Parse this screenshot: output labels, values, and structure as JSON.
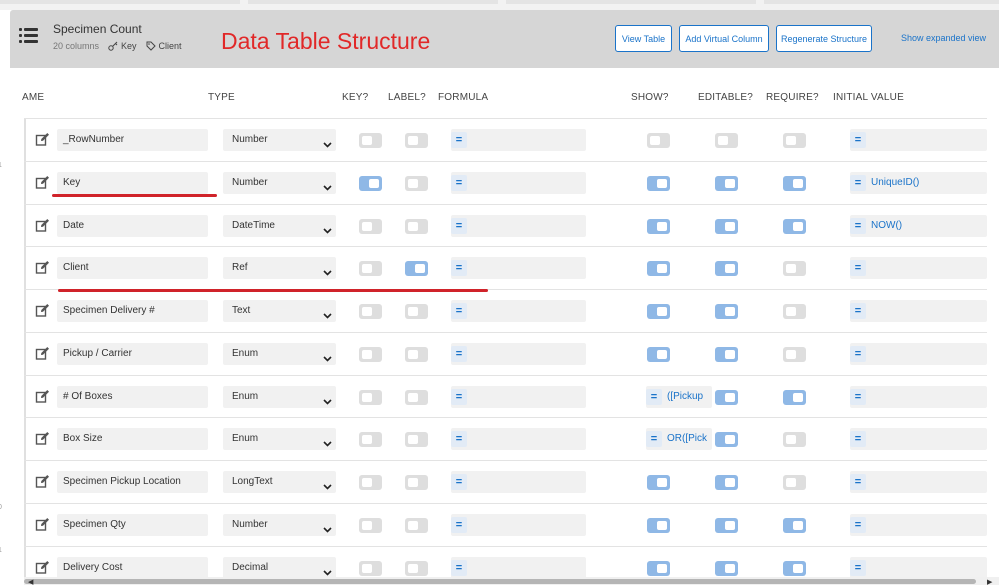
{
  "table": {
    "name": "Specimen Count",
    "columns_count": "20 columns",
    "key_column": "Key",
    "label_column": "Client"
  },
  "annotation_title": "Data Table Structure",
  "buttons": {
    "view_table": "View Table",
    "add_virtual_column": "Add Virtual Column",
    "regenerate_structure": "Regenerate Structure"
  },
  "expanded_view_link": "Show expanded view",
  "column_headers": {
    "name": "AME",
    "type": "TYPE",
    "key": "KEY?",
    "label": "LABEL?",
    "formula": "FORMULA",
    "show": "SHOW?",
    "editable": "EDITABLE?",
    "require": "REQUIRE?",
    "initial_value": "INITIAL VALUE"
  },
  "rows": [
    {
      "num": "",
      "name": "_RowNumber",
      "type": "Number",
      "key": false,
      "label": false,
      "formula": "",
      "show": false,
      "show_formula": "",
      "editable": false,
      "require": false,
      "initial_value": ""
    },
    {
      "num": "1",
      "name": "Key",
      "type": "Number",
      "key": true,
      "label": false,
      "formula": "",
      "show": true,
      "show_formula": "",
      "editable": true,
      "require": true,
      "initial_value": "UniqueID()"
    },
    {
      "num": "",
      "name": "Date",
      "type": "DateTime",
      "key": false,
      "label": false,
      "formula": "",
      "show": true,
      "show_formula": "",
      "editable": true,
      "require": true,
      "initial_value": "NOW()"
    },
    {
      "num": "",
      "name": "Client",
      "type": "Ref",
      "key": false,
      "label": true,
      "formula": "",
      "show": true,
      "show_formula": "",
      "editable": true,
      "require": false,
      "initial_value": ""
    },
    {
      "num": "",
      "name": "Specimen Delivery #",
      "type": "Text",
      "key": false,
      "label": false,
      "formula": "",
      "show": true,
      "show_formula": "",
      "editable": true,
      "require": false,
      "initial_value": ""
    },
    {
      "num": "",
      "name": "Pickup / Carrier",
      "type": "Enum",
      "key": false,
      "label": false,
      "formula": "",
      "show": true,
      "show_formula": "",
      "editable": true,
      "require": false,
      "initial_value": ""
    },
    {
      "num": "",
      "name": "# Of Boxes",
      "type": "Enum",
      "key": false,
      "label": false,
      "formula": "",
      "show": false,
      "show_formula": "([Pickup",
      "editable": true,
      "require": true,
      "initial_value": ""
    },
    {
      "num": "",
      "name": "Box Size",
      "type": "Enum",
      "key": false,
      "label": false,
      "formula": "",
      "show": false,
      "show_formula": "OR([Pick",
      "editable": true,
      "require": false,
      "initial_value": ""
    },
    {
      "num": "",
      "name": "Specimen Pickup Location",
      "type": "LongText",
      "key": false,
      "label": false,
      "formula": "",
      "show": true,
      "show_formula": "",
      "editable": true,
      "require": false,
      "initial_value": ""
    },
    {
      "num": "0",
      "name": "Specimen Qty",
      "type": "Number",
      "key": false,
      "label": false,
      "formula": "",
      "show": true,
      "show_formula": "",
      "editable": true,
      "require": true,
      "initial_value": ""
    },
    {
      "num": "1",
      "name": "Delivery Cost",
      "type": "Decimal",
      "key": false,
      "label": false,
      "formula": "",
      "show": true,
      "show_formula": "",
      "editable": true,
      "require": true,
      "initial_value": ""
    }
  ],
  "colors": {
    "accent": "#1a73c9",
    "toggle_on": "#8fb8e6",
    "toggle_off": "#dedede",
    "annotation": "#e12828",
    "header_bg": "#d6d6d6"
  },
  "icons": [
    "menu-icon",
    "key-icon",
    "tag-icon",
    "edit-icon",
    "chevron-down-icon",
    "equals-icon"
  ]
}
